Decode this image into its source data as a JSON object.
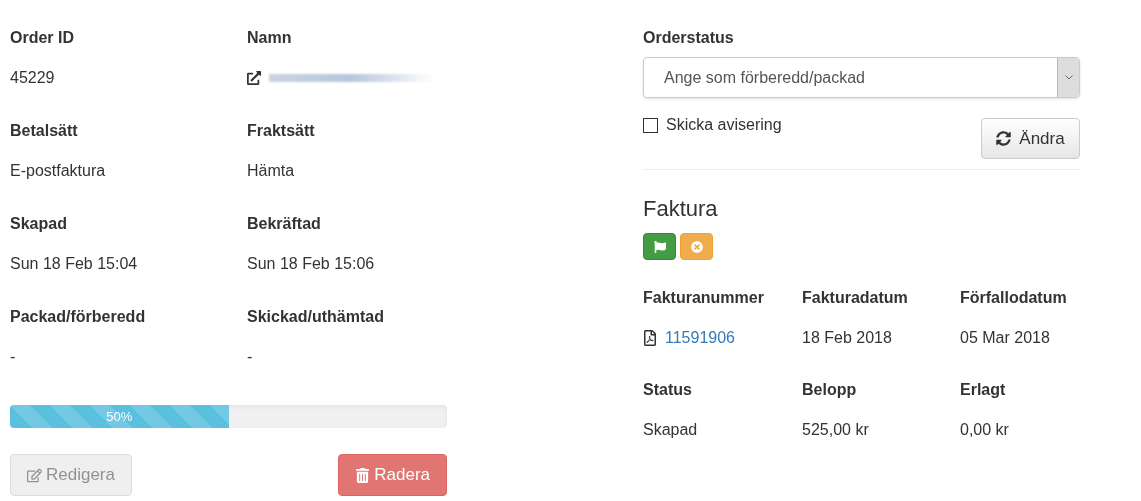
{
  "order_fields": [
    {
      "label": "Order ID",
      "value": "45229",
      "kind": "text"
    },
    {
      "label": "Namn",
      "kind": "redacted_link"
    },
    {
      "label": "Betalsätt",
      "value": "E-postfaktura",
      "kind": "text"
    },
    {
      "label": "Fraktsätt",
      "value": "Hämta",
      "kind": "text"
    },
    {
      "label": "Skapad",
      "value": "Sun 18 Feb 15:04",
      "kind": "text"
    },
    {
      "label": "Bekräftad",
      "value": "Sun 18 Feb 15:06",
      "kind": "text"
    },
    {
      "label": "Packad/förberedd",
      "value": "-",
      "kind": "text"
    },
    {
      "label": "Skickad/uthämtad",
      "value": "-",
      "kind": "text"
    }
  ],
  "progress": {
    "level": 0.5,
    "reading": "50%"
  },
  "buttons": [
    {
      "label": "Redigera",
      "kind": "edit",
      "disabled": true
    },
    {
      "label": "Radera",
      "kind": "delete",
      "disabled": true
    }
  ],
  "order_status": {
    "label": "Orderstatus",
    "value": "Ange som förberedd/packad"
  },
  "notify": {
    "label": "Skicka avisering",
    "checked": false
  },
  "change_button": {
    "label": "Ändra"
  },
  "invoice": {
    "title": "Faktura",
    "actions": [
      {
        "kind": "flag"
      },
      {
        "kind": "cancel"
      }
    ],
    "fields": [
      {
        "label": "Fakturanummer",
        "value": "11591906",
        "kind": "pdf_link"
      },
      {
        "label": "Fakturadatum",
        "value": "18 Feb 2018",
        "kind": "text"
      },
      {
        "label": "Förfallodatum",
        "value": "05 Mar 2018",
        "kind": "text"
      },
      {
        "label": "Status",
        "value": "Skapad",
        "kind": "text"
      },
      {
        "label": "Belopp",
        "value": "525,00 kr",
        "kind": "text"
      },
      {
        "label": "Erlagt",
        "value": "0,00 kr",
        "kind": "text"
      }
    ]
  }
}
